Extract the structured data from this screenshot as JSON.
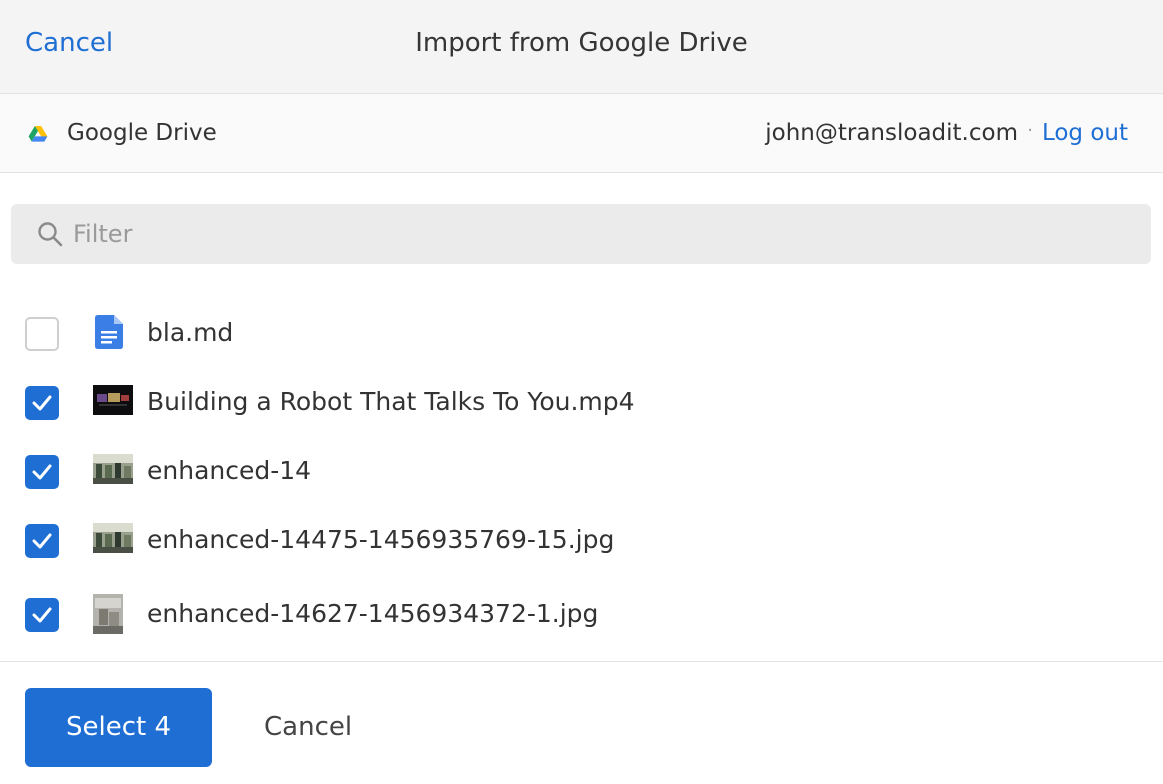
{
  "header": {
    "cancel_label": "Cancel",
    "title": "Import from Google Drive"
  },
  "provider": {
    "name": "Google Drive",
    "icon": "google-drive-icon",
    "user_email": "john@transloadit.com",
    "separator": "·",
    "logout_label": "Log out"
  },
  "filter": {
    "placeholder": "Filter",
    "value": "",
    "icon": "search-icon"
  },
  "files": [
    {
      "name": "bla.md",
      "checked": false,
      "thumb": "document-icon"
    },
    {
      "name": "Building a Robot That Talks To You.mp4",
      "checked": true,
      "thumb": "video-thumbnail"
    },
    {
      "name": "enhanced-14",
      "checked": true,
      "thumb": "image-thumbnail"
    },
    {
      "name": "enhanced-14475-1456935769-15.jpg",
      "checked": true,
      "thumb": "image-thumbnail"
    },
    {
      "name": "enhanced-14627-1456934372-1.jpg",
      "checked": true,
      "thumb": "image-thumbnail"
    }
  ],
  "footer": {
    "select_label": "Select 4",
    "cancel_label": "Cancel"
  },
  "colors": {
    "accent": "#1f6ed4",
    "header_bg": "#f4f4f4",
    "filter_bg": "#ebebeb"
  }
}
